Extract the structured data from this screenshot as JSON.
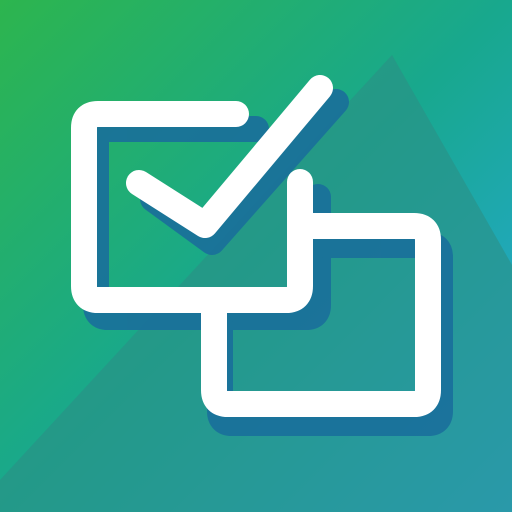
{
  "icon": {
    "name": "checkbox-windows-app-icon",
    "glyphs": [
      "checkmark-icon",
      "window-outline-icon",
      "window-outline-icon"
    ],
    "colors": {
      "gradient_start": "#2DB54E",
      "gradient_mid": "#18A88E",
      "gradient_end": "#28A8E0",
      "mountain": "#2B8F86",
      "shadow": "#1A6F9B",
      "stroke": "#FFFFFF"
    }
  }
}
